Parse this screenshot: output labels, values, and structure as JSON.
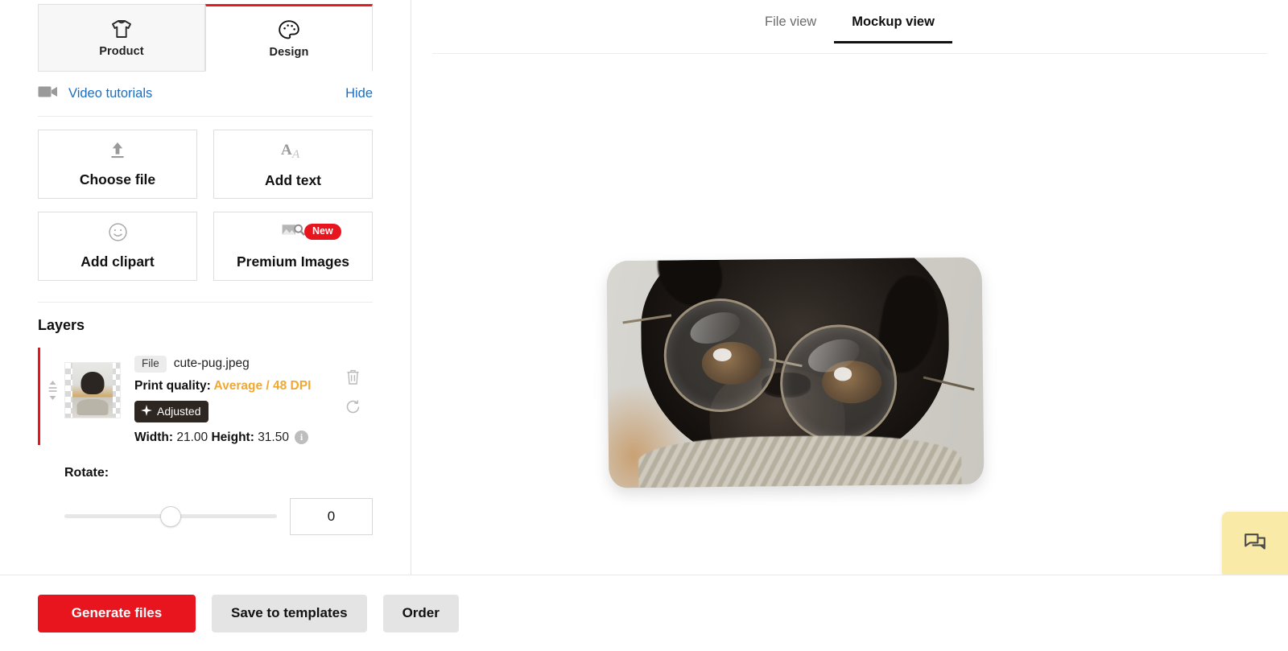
{
  "left_panel": {
    "tabs": [
      {
        "label": "Product",
        "icon": "tshirt-icon",
        "active": false
      },
      {
        "label": "Design",
        "icon": "palette-icon",
        "active": true
      }
    ],
    "tutorials": {
      "icon": "video-camera-icon",
      "link_label": "Video tutorials",
      "hide_label": "Hide"
    },
    "actions": [
      {
        "label": "Choose file",
        "icon": "upload-icon",
        "badge": ""
      },
      {
        "label": "Add text",
        "icon": "text-icon",
        "badge": ""
      },
      {
        "label": "Add clipart",
        "icon": "smiley-icon",
        "badge": ""
      },
      {
        "label": "Premium Images",
        "icon": "image-search-icon",
        "badge": "New"
      }
    ],
    "layers": {
      "title": "Layers",
      "items": [
        {
          "type_chip": "File",
          "file_name": "cute-pug.jpeg",
          "print_quality_label": "Print quality:",
          "print_quality_value": "Average / 48 DPI",
          "adjusted_badge": "Adjusted",
          "width_label": "Width:",
          "width_value": "21.00",
          "height_label": "Height:",
          "height_value": "31.50",
          "info_glyph": "i",
          "delete_icon": "trash-icon",
          "reset_icon": "reset-icon",
          "drag_icon": "drag-handle-icon"
        }
      ]
    },
    "rotate": {
      "label": "Rotate:",
      "value": "0",
      "min": -180,
      "max": 180
    }
  },
  "bottom_bar": {
    "generate_label": "Generate files",
    "save_label": "Save to templates",
    "order_label": "Order"
  },
  "right_panel": {
    "view_tabs": [
      {
        "label": "File view",
        "active": false
      },
      {
        "label": "Mockup view",
        "active": true
      }
    ],
    "mockup": {
      "alt": "pillow-mockup-pug-with-glasses"
    }
  },
  "chat_widget": {
    "icon": "chat-bubbles-icon"
  },
  "colors": {
    "accent_red": "#e8141e",
    "active_tab_red": "#e31b23",
    "link_blue": "#1a6fc4",
    "warning_orange": "#f0a830",
    "chat_yellow": "#faeaa8",
    "badge_dark": "#2e2621"
  }
}
